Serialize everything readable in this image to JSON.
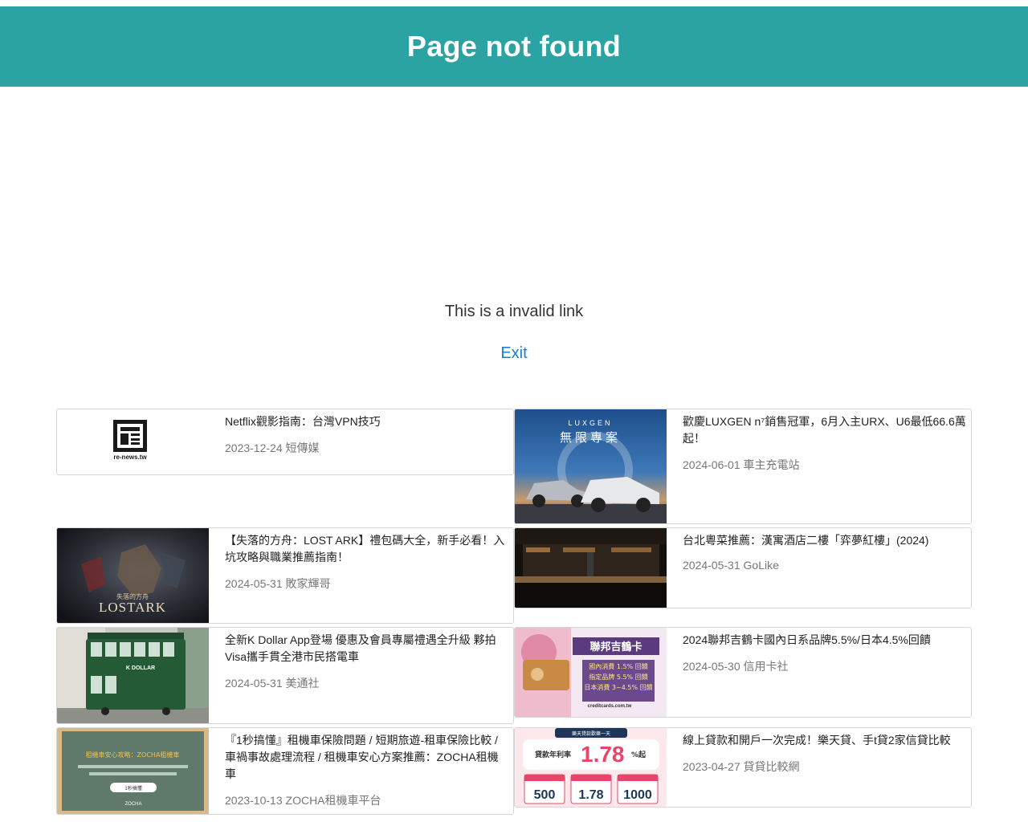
{
  "header": {
    "title": "Page not found"
  },
  "message": "This is a invalid link",
  "exit_label": "Exit",
  "articles": [
    {
      "title": "Netflix觀影指南：台灣VPN技巧",
      "date": "2023-12-24",
      "source": "短傳媒",
      "logo_text": "re-news.tw"
    },
    {
      "title": "歡慶LUXGEN n⁷銷售冠軍，6月入主URX、U6最低66.6萬起！",
      "date": "2024-06-01",
      "source": "車主充電站",
      "img_brand": "LUXGEN",
      "img_caption": "無限專案"
    },
    {
      "title": "【失落的方舟：LOST ARK】禮包碼大全，新手必看！入坑攻略與職業推薦指南！",
      "date": "2024-05-31",
      "source": "敗家輝哥",
      "img_caption": "LOSTARK",
      "img_subcaption": "失落的方舟"
    },
    {
      "title": "台北粵菜推薦：漢寓酒店二樓「弈夢紅樓」(2024)",
      "date": "2024-05-31",
      "source": "GoLike"
    },
    {
      "title": "全新K Dollar App登場 優惠及會員專屬禮遇全升級 夥拍Visa攜手貫全港市民搭電車",
      "date": "2024-05-31",
      "source": "美通社",
      "img_caption": "K DOLLAR"
    },
    {
      "title": "2024聯邦吉鶴卡國內日系品牌5.5%/日本4.5%回饋",
      "date": "2024-05-30",
      "source": "信用卡社",
      "img_caption": "聯邦吉鶴卡",
      "img_lines": [
        "國內消費 1.5% 回饋",
        "指定品牌 5.5% 回饋",
        "日本消費 3~4.5% 回饋"
      ],
      "img_footer": "creditcards.com.tw"
    },
    {
      "title": "『1秒搞懂』租機車保險問題 / 短期旅遊-租車保險比較 / 車禍事故處理流程 / 租機車安心方案推薦：ZOCHA租機車",
      "date": "2023-10-13",
      "source": "ZOCHA租機車平台",
      "img_caption": "租機車安心攻略：ZOCHA租機車",
      "img_button": "1秒搞懂",
      "img_footer": "ZOCHA"
    },
    {
      "title": "線上貸款和開戶一次完成！樂天貸、手t貸2家信貸比較",
      "date": "2023-04-27",
      "source": "貸貸比較網",
      "img_top": "樂天貸款歡樂一天",
      "img_rate_label": "貸款年利率",
      "img_rate": "1.78",
      "img_rate_unit": "%起",
      "img_stats": [
        "500",
        "1.78",
        "1000"
      ]
    }
  ],
  "colors": {
    "header_bg": "#2ba3a3",
    "link": "#1a7fd4"
  }
}
